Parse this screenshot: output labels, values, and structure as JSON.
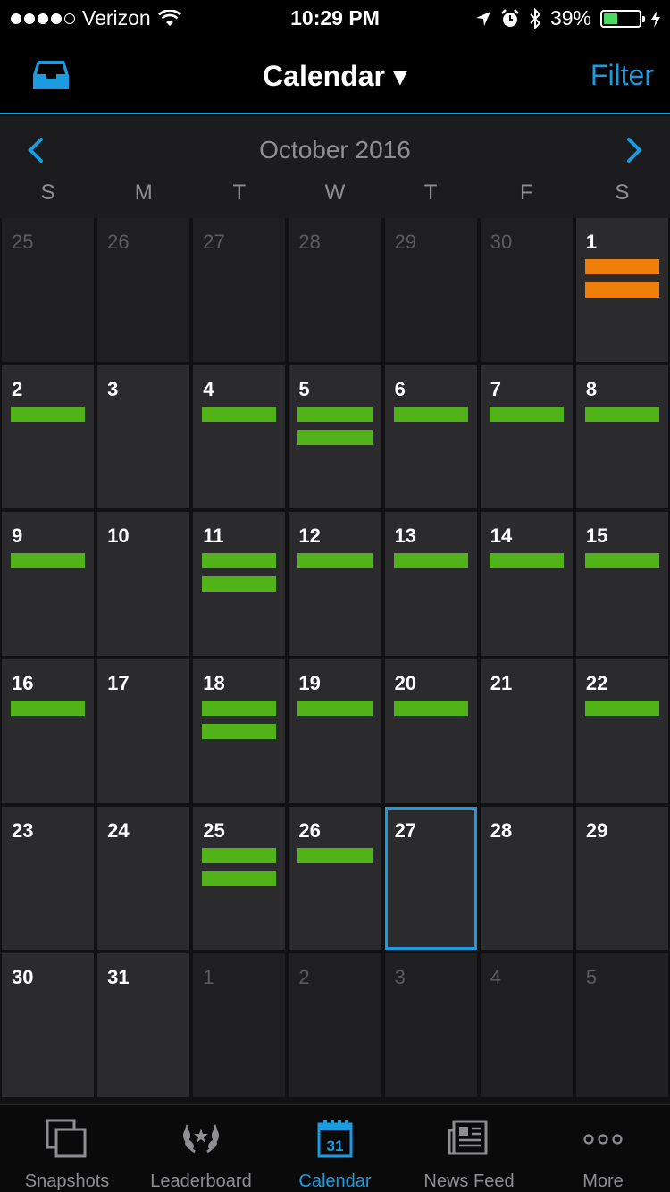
{
  "status_bar": {
    "carrier": "Verizon",
    "time": "10:29 PM",
    "battery": "39%",
    "battery_level": 0.39,
    "signal_bars_filled": 4
  },
  "nav": {
    "title": "Calendar ▾",
    "filter_label": "Filter",
    "inbox_icon": "inbox-icon"
  },
  "calendar": {
    "month_label": "October 2016",
    "weekdays": [
      "S",
      "M",
      "T",
      "W",
      "T",
      "F",
      "S"
    ],
    "today": "27",
    "colors": {
      "green": "#52b318",
      "orange": "#f07f0a",
      "accent": "#1b9be0"
    },
    "days": [
      {
        "d": "25",
        "other": true,
        "bars": []
      },
      {
        "d": "26",
        "other": true,
        "bars": []
      },
      {
        "d": "27",
        "other": true,
        "bars": []
      },
      {
        "d": "28",
        "other": true,
        "bars": []
      },
      {
        "d": "29",
        "other": true,
        "bars": []
      },
      {
        "d": "30",
        "other": true,
        "bars": []
      },
      {
        "d": "1",
        "other": false,
        "bars": [
          "orange",
          "orange"
        ]
      },
      {
        "d": "2",
        "other": false,
        "bars": [
          "green"
        ]
      },
      {
        "d": "3",
        "other": false,
        "bars": []
      },
      {
        "d": "4",
        "other": false,
        "bars": [
          "green"
        ]
      },
      {
        "d": "5",
        "other": false,
        "bars": [
          "green",
          "green"
        ]
      },
      {
        "d": "6",
        "other": false,
        "bars": [
          "green"
        ]
      },
      {
        "d": "7",
        "other": false,
        "bars": [
          "green"
        ]
      },
      {
        "d": "8",
        "other": false,
        "bars": [
          "green"
        ]
      },
      {
        "d": "9",
        "other": false,
        "bars": [
          "green"
        ]
      },
      {
        "d": "10",
        "other": false,
        "bars": []
      },
      {
        "d": "11",
        "other": false,
        "bars": [
          "green",
          "green"
        ]
      },
      {
        "d": "12",
        "other": false,
        "bars": [
          "green"
        ]
      },
      {
        "d": "13",
        "other": false,
        "bars": [
          "green"
        ]
      },
      {
        "d": "14",
        "other": false,
        "bars": [
          "green"
        ]
      },
      {
        "d": "15",
        "other": false,
        "bars": [
          "green"
        ]
      },
      {
        "d": "16",
        "other": false,
        "bars": [
          "green"
        ]
      },
      {
        "d": "17",
        "other": false,
        "bars": []
      },
      {
        "d": "18",
        "other": false,
        "bars": [
          "green",
          "green"
        ]
      },
      {
        "d": "19",
        "other": false,
        "bars": [
          "green"
        ]
      },
      {
        "d": "20",
        "other": false,
        "bars": [
          "green"
        ]
      },
      {
        "d": "21",
        "other": false,
        "bars": []
      },
      {
        "d": "22",
        "other": false,
        "bars": [
          "green"
        ]
      },
      {
        "d": "23",
        "other": false,
        "bars": []
      },
      {
        "d": "24",
        "other": false,
        "bars": []
      },
      {
        "d": "25",
        "other": false,
        "bars": [
          "green",
          "green"
        ]
      },
      {
        "d": "26",
        "other": false,
        "bars": [
          "green"
        ]
      },
      {
        "d": "27",
        "other": false,
        "bars": []
      },
      {
        "d": "28",
        "other": false,
        "bars": []
      },
      {
        "d": "29",
        "other": false,
        "bars": []
      },
      {
        "d": "30",
        "other": false,
        "bars": []
      },
      {
        "d": "31",
        "other": false,
        "bars": []
      },
      {
        "d": "1",
        "other": true,
        "bars": []
      },
      {
        "d": "2",
        "other": true,
        "bars": []
      },
      {
        "d": "3",
        "other": true,
        "bars": []
      },
      {
        "d": "4",
        "other": true,
        "bars": []
      },
      {
        "d": "5",
        "other": true,
        "bars": []
      }
    ]
  },
  "tabbar": {
    "tabs": [
      {
        "label": "Snapshots",
        "icon": "snapshots-icon",
        "active": false
      },
      {
        "label": "Leaderboard",
        "icon": "laurel-icon",
        "active": false
      },
      {
        "label": "Calendar",
        "icon": "calendar-icon",
        "active": true
      },
      {
        "label": "News Feed",
        "icon": "newspaper-icon",
        "active": false
      },
      {
        "label": "More",
        "icon": "more-icon",
        "active": false
      }
    ],
    "calendar_icon_day": "31"
  }
}
